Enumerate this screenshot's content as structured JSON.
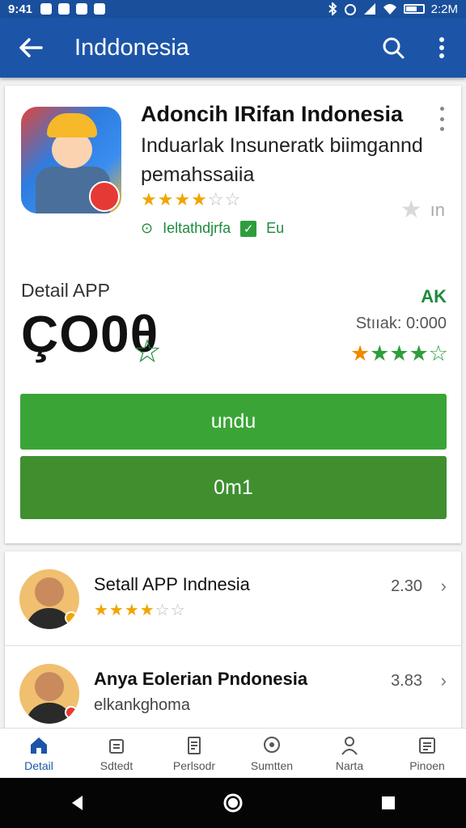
{
  "status_bar": {
    "time": "9:41",
    "clock_right": "2:2M"
  },
  "app_bar": {
    "title": "Inddonesia"
  },
  "app": {
    "title": "Adoncih IRifan Indonesia",
    "subtitle": "Induarlak Insuneratk biimgannd pemahssaiia",
    "rating_stars": 4,
    "meta_left": "Ieltathdjrfa",
    "meta_right": "Eu",
    "fav_label": "ın",
    "detail_label": "Detail APP",
    "price": "ÇO0θ",
    "rating_label": "AK",
    "status_text": "Stııak: 0:000",
    "install_label": "undu",
    "open_label": "0m1"
  },
  "related": [
    {
      "name": "Setall APP Indnesia",
      "rating_stars": 4,
      "count": "2.30"
    },
    {
      "name": "Anya Eolerian Pndonesia",
      "subtitle": "elkankghoma",
      "count": "3.83"
    }
  ],
  "bottom_nav": [
    {
      "label": "Detail",
      "icon": "home-icon"
    },
    {
      "label": "Sdtedt",
      "icon": "share-icon"
    },
    {
      "label": "Perlsodr",
      "icon": "document-icon"
    },
    {
      "label": "Sumtten",
      "icon": "chat-icon"
    },
    {
      "label": "Narta",
      "icon": "person-icon"
    },
    {
      "label": "Pinoen",
      "icon": "list-icon"
    }
  ],
  "colors": {
    "primary": "#1c55a8",
    "green": "#3aa536",
    "green_dark": "#3f8f2f",
    "star": "#f0a500"
  }
}
